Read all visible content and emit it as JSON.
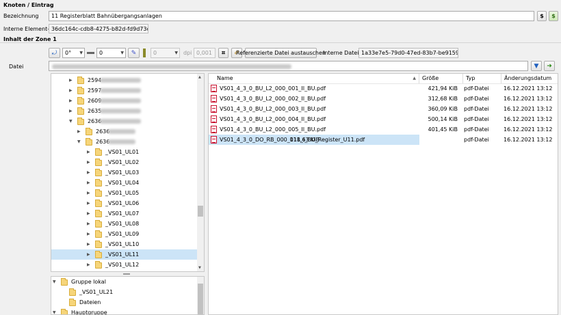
{
  "section_title": "Knoten / Eintrag",
  "bezeichnung": {
    "label": "Bezeichnung",
    "value": "11 Registerblatt Bahnübergangsanlagen"
  },
  "element_id": {
    "label": "Interne Element-ID",
    "value": "36dc164c-cdb8-4275-b82d-fd9d73d1fc79"
  },
  "zone_title": "Inhalt der Zone 1",
  "toolbar": {
    "rotation": "0°",
    "line_width": "0",
    "color_value": "0",
    "dpi_label": "dpi",
    "dpi_value": "0,001",
    "replace_button": "Referenzierte Datei austauschen",
    "file_id_label": "Interne Datei-ID",
    "file_id_value": "1a33e7e5-79d0-47ed-83b7-be9159b01a8e"
  },
  "datei": {
    "label": "Datei",
    "value": ""
  },
  "tree": {
    "items": [
      {
        "label": "2594",
        "expanded": false
      },
      {
        "label": "2597",
        "expanded": false
      },
      {
        "label": "2609",
        "expanded": false
      },
      {
        "label": "2635",
        "expanded": false
      },
      {
        "label": "2636",
        "expanded": true
      },
      {
        "label": "2636",
        "expanded": false
      },
      {
        "label": "2636",
        "expanded": true
      },
      {
        "label": "_VS01_UL01"
      },
      {
        "label": "_VS01_UL02"
      },
      {
        "label": "_VS01_UL03"
      },
      {
        "label": "_VS01_UL04"
      },
      {
        "label": "_VS01_UL05"
      },
      {
        "label": "_VS01_UL06"
      },
      {
        "label": "_VS01_UL07"
      },
      {
        "label": "_VS01_UL08"
      },
      {
        "label": "_VS01_UL09"
      },
      {
        "label": "_VS01_UL10"
      },
      {
        "label": "_VS01_UL11"
      },
      {
        "label": "_VS01_UL12"
      }
    ]
  },
  "groups": {
    "items": [
      {
        "label": "Gruppe lokal"
      },
      {
        "label": "_VS01_UL21"
      },
      {
        "label": "Dateien"
      },
      {
        "label": "Hauptgruppe"
      }
    ]
  },
  "files": {
    "columns": [
      "Name",
      "Größe",
      "Typ",
      "Änderungsdatum"
    ],
    "rows": [
      {
        "name": "VS01_4_3_0_BU_L2_000_001_II_BU.pdf",
        "size": "421,94 KiB",
        "type": "pdf-Datei",
        "date": "16.12.2021 13:12"
      },
      {
        "name": "VS01_4_3_0_BU_L2_000_002_II_BU.pdf",
        "size": "312,68 KiB",
        "type": "pdf-Datei",
        "date": "16.12.2021 13:12"
      },
      {
        "name": "VS01_4_3_0_BU_L2_000_003_II_BU.pdf",
        "size": "360,09 KiB",
        "type": "pdf-Datei",
        "date": "16.12.2021 13:12"
      },
      {
        "name": "VS01_4_3_0_BU_L2_000_004_II_BU.pdf",
        "size": "500,14 KiB",
        "type": "pdf-Datei",
        "date": "16.12.2021 13:12"
      },
      {
        "name": "VS01_4_3_0_BU_L2_000_005_II_BU.pdf",
        "size": "401,45 KiB",
        "type": "pdf-Datei",
        "date": "16.12.2021 13:12"
      },
      {
        "name": "VS01_4_3_0_DO_RB_000_011_I_BU_Register_U11.pdf",
        "size": "118,63 KiB",
        "type": "pdf-Datei",
        "date": "16.12.2021 13:12"
      }
    ]
  }
}
